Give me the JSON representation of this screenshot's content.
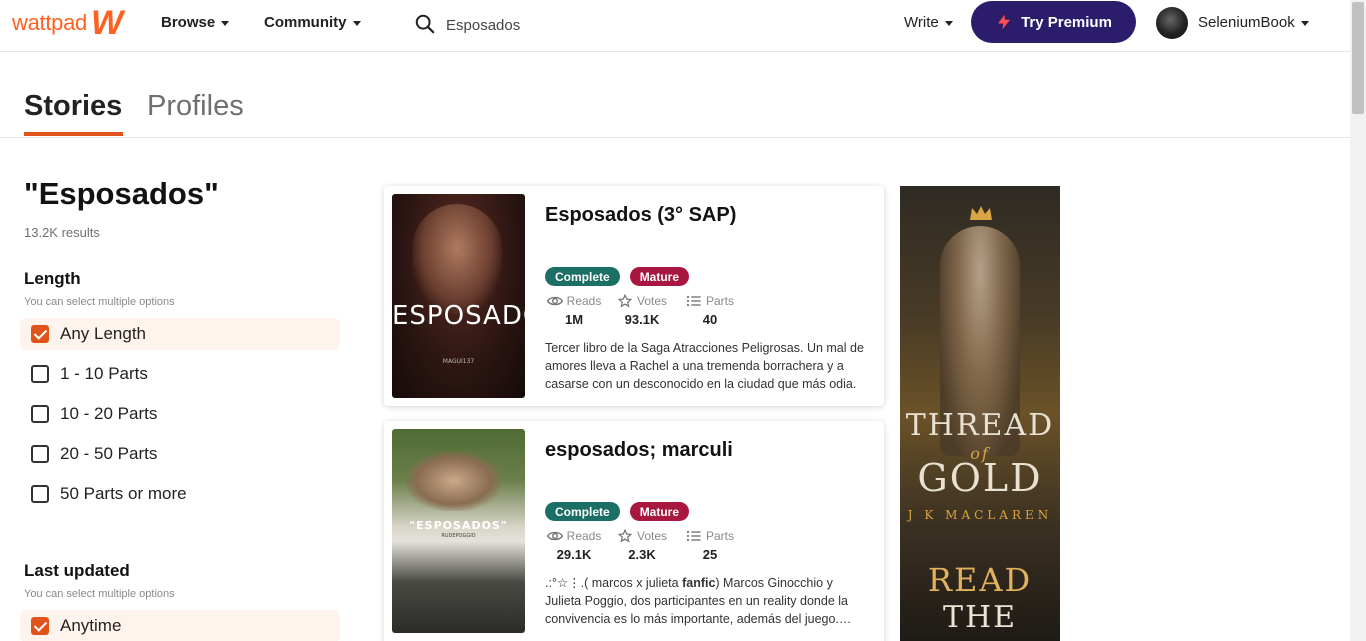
{
  "header": {
    "logo_text": "wattpad",
    "logo_mark": "W",
    "nav": [
      {
        "label": "Browse"
      },
      {
        "label": "Community"
      }
    ],
    "search_value": "Esposados",
    "write_label": "Write",
    "premium_label": "Try Premium",
    "username": "SeleniumBook"
  },
  "tabs": [
    {
      "label": "Stories",
      "active": true
    },
    {
      "label": "Profiles",
      "active": false
    }
  ],
  "sidebar": {
    "query": "\"Esposados\"",
    "result_count": "13.2K results",
    "length": {
      "title": "Length",
      "hint": "You can select multiple options",
      "options": [
        {
          "label": "Any Length",
          "checked": true
        },
        {
          "label": "1 - 10 Parts",
          "checked": false
        },
        {
          "label": "10 - 20 Parts",
          "checked": false
        },
        {
          "label": "20 - 50 Parts",
          "checked": false
        },
        {
          "label": "50 Parts or more",
          "checked": false
        }
      ]
    },
    "updated": {
      "title": "Last updated",
      "hint": "You can select multiple options",
      "options": [
        {
          "label": "Anytime",
          "checked": true
        }
      ]
    }
  },
  "stories": [
    {
      "title": "Esposados (3° SAP)",
      "cover_text": "ESPOSADOS",
      "cover_sub": "MAGUI137",
      "badges": [
        "Complete",
        "Mature"
      ],
      "stats": {
        "reads_label": "Reads",
        "reads": "1M",
        "votes_label": "Votes",
        "votes": "93.1K",
        "parts_label": "Parts",
        "parts": "40"
      },
      "description": "Tercer libro de la Saga Atracciones Peligrosas. Un mal de amores lleva a Rachel a una tremenda borrachera y a casarse con un desconocido en la ciudad que más odia. A…"
    },
    {
      "title": "esposados; marculi",
      "cover_text": "\"ESPOSADOS\"",
      "cover_sub": "RUDEPOGGIO",
      "badges": [
        "Complete",
        "Mature"
      ],
      "stats": {
        "reads_label": "Reads",
        "reads": "29.1K",
        "votes_label": "Votes",
        "votes": "2.3K",
        "parts_label": "Parts",
        "parts": "25"
      },
      "description_prefix": ".:°☆⋮.( marcos x julieta ",
      "description_bold": "fanfic",
      "description_rest": ") Marcos Ginocchio y Julieta Poggio, dos participantes en un reality donde la convivencia es lo más importante, además del juego.…"
    }
  ],
  "ad": {
    "title_line1": "THREAD",
    "title_line2": "GOLD",
    "title_of": "of",
    "author": "J K MACLAREN",
    "cta_line1": "READ",
    "cta_line2": "THE"
  },
  "colors": {
    "brand": "#ff6122",
    "premium": "#2b1c6c",
    "complete": "#1c6f65",
    "mature": "#a8173f",
    "accent": "#e0541c"
  }
}
